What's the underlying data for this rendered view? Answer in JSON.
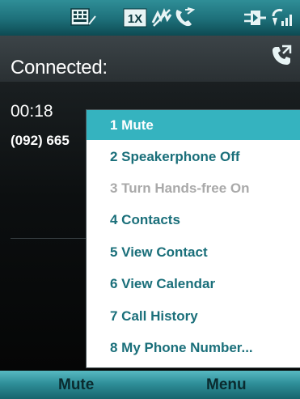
{
  "status_bar": {
    "icons": [
      "keyboard-icon",
      "1x-network-icon",
      "sync-off-icon",
      "phone-call-icon",
      "power-plug-icon",
      "signal-strength-icon"
    ],
    "network_label": "1X"
  },
  "call": {
    "status": "Connected:",
    "duration": "00:18",
    "number": "(092) 665"
  },
  "menu": {
    "items": [
      {
        "label": "1 Mute",
        "state": "selected"
      },
      {
        "label": "2 Speakerphone Off",
        "state": "enabled"
      },
      {
        "label": "3 Turn Hands-free On",
        "state": "disabled"
      },
      {
        "label": "4 Contacts",
        "state": "enabled"
      },
      {
        "label": "5 View Contact",
        "state": "enabled"
      },
      {
        "label": "6 View Calendar",
        "state": "enabled"
      },
      {
        "label": "7 Call History",
        "state": "enabled"
      },
      {
        "label": "8 My Phone Number...",
        "state": "enabled"
      }
    ]
  },
  "softkeys": {
    "left": "Mute",
    "right": "Menu"
  },
  "colors": {
    "accent": "#35b3bf",
    "menu_text": "#1a6f7a",
    "disabled_text": "#a9a9a9",
    "bar": "#2f8f99"
  }
}
